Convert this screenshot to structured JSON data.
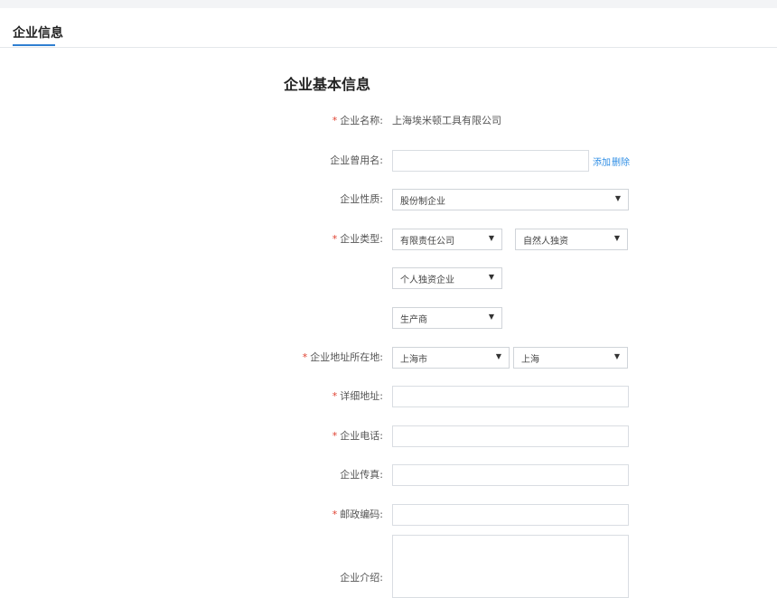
{
  "tabs": {
    "active_label": "企业信息"
  },
  "form": {
    "title": "企业基本信息",
    "required_mark": "*",
    "company_name": {
      "label": "企业名称:",
      "value": "上海埃米顿工具有限公司"
    },
    "former_name": {
      "label": "企业曾用名:",
      "value": "",
      "add_label": "添加",
      "delete_label": "删除"
    },
    "company_nature": {
      "label": "企业性质:",
      "selected": "股份制企业"
    },
    "company_type": {
      "label": "企业类型:",
      "select1": "有限责任公司",
      "select2": "自然人独资",
      "select3": "个人独资企业",
      "select4": "生产商"
    },
    "company_location": {
      "label": "企业地址所在地:",
      "city": "上海市",
      "district": "上海"
    },
    "detail_address": {
      "label": "详细地址:",
      "value": ""
    },
    "company_phone": {
      "label": "企业电话:",
      "value": ""
    },
    "company_fax": {
      "label": "企业传真:",
      "value": ""
    },
    "postal_code": {
      "label": "邮政编码:",
      "value": ""
    },
    "company_intro": {
      "label": "企业介绍:",
      "value": ""
    }
  },
  "icons": {
    "dropdown": "▼"
  }
}
